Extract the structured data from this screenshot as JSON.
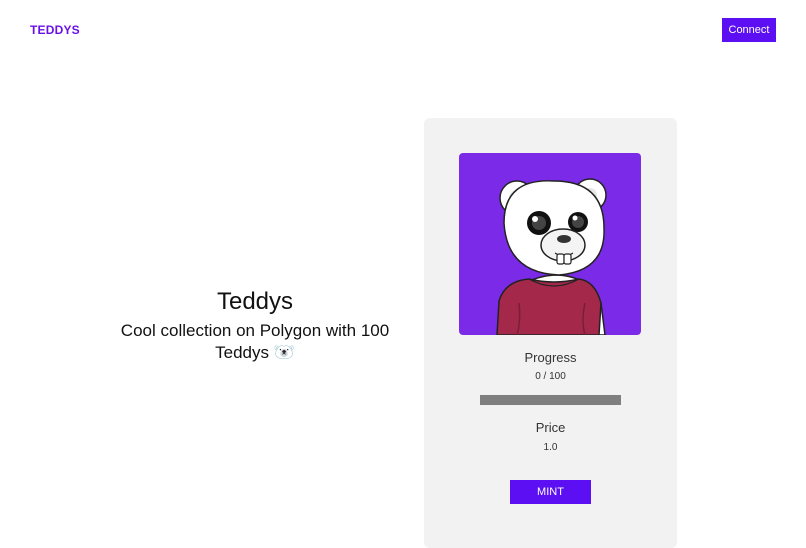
{
  "header": {
    "brand": "TEDDYS",
    "connect_label": "Connect"
  },
  "hero": {
    "title": "Teddys",
    "description": "Cool collection on Polygon with 100 Teddys 🐻‍❄️"
  },
  "mint_card": {
    "image_icon": "polar-bear-nft-illustration",
    "progress_label": "Progress",
    "progress_text": "0 / 100",
    "progress_minted": 0,
    "progress_total": 100,
    "price_label": "Price",
    "price_value": "1.0",
    "mint_label": "MINT"
  },
  "colors": {
    "accent": "#5b0ff2",
    "brand_text": "#6a11e8",
    "nft_background": "#7b2be8",
    "card_background": "#f2f2f2",
    "progress_track": "#7f7f7f"
  }
}
